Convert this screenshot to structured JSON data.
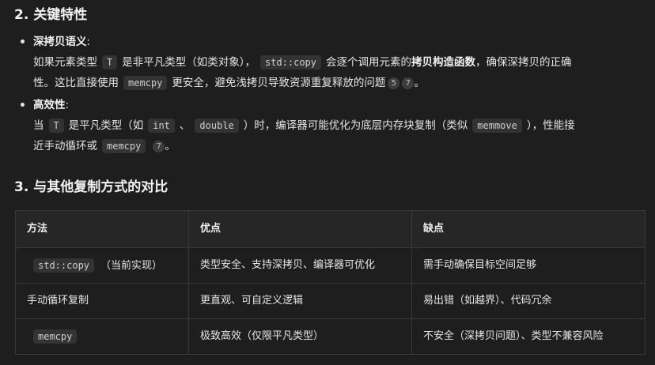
{
  "section2": {
    "heading": "2. 关键特性",
    "items": [
      {
        "title": "深拷贝语义",
        "colon": ":",
        "l1_a": "如果元素类型",
        "code_t": "T",
        "l1_b": "是非平凡类型（如类对象），",
        "code_copy": "std::copy",
        "l1_c": "会逐个调用元素的",
        "bold_ctor": "拷贝构造函数",
        "l1_d": "，确保深拷贝的正确",
        "l2_a": "性。这比直接使用",
        "code_memcpy": "memcpy",
        "l2_b": "更安全，避免浅拷贝导致资源重复释放的问题",
        "cite1": "5",
        "cite2": "7",
        "l2_end": "。"
      },
      {
        "title": "高效性",
        "colon": ":",
        "l1_a": "当",
        "code_t": "T",
        "l1_b": "是平凡类型（如",
        "code_int": "int",
        "l1_sep": "、",
        "code_double": "double",
        "l1_c": "）时，编译器可能优化为底层内存块复制（类似",
        "code_memmove": "memmove",
        "l1_d": "），性能接",
        "l2_a": "近手动循环或",
        "code_memcpy": "memcpy",
        "cite1": "7",
        "l2_end": "。"
      }
    ]
  },
  "section3": {
    "heading": "3. 与其他复制方式的对比",
    "table": {
      "headers": [
        "方法",
        "优点",
        "缺点"
      ],
      "rows": [
        {
          "method_code": "std::copy",
          "method_text": "（当前实现）",
          "pros": "类型安全、支持深拷贝、编译器可优化",
          "cons": "需手动确保目标空间足够"
        },
        {
          "method_code": "",
          "method_text": "手动循环复制",
          "pros": "更直观、可自定义逻辑",
          "cons": "易出错（如越界）、代码冗余"
        },
        {
          "method_code": "memcpy",
          "method_text": "",
          "pros": "极致高效（仅限平凡类型）",
          "cons": "不安全（深拷贝问题）、类型不兼容风险"
        }
      ]
    }
  }
}
